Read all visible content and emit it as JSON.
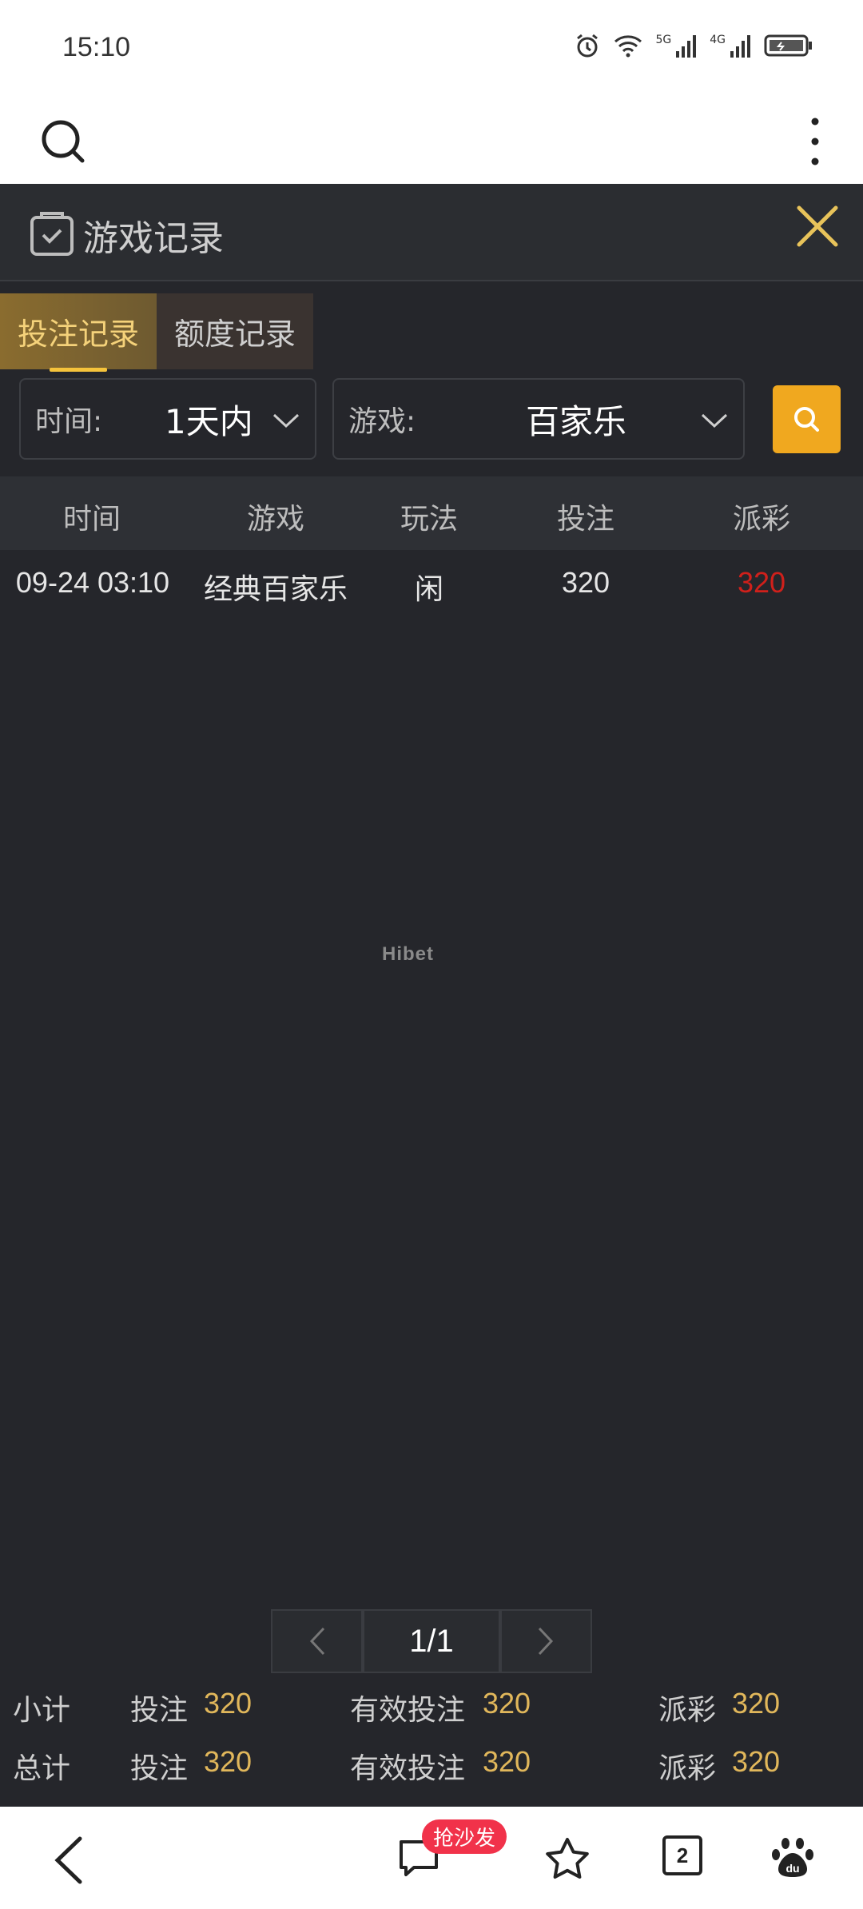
{
  "status_bar": {
    "time": "15:10",
    "network1": "5G",
    "network2": "4G"
  },
  "panel": {
    "title": "游戏记录"
  },
  "tabs": [
    {
      "label": "投注记录",
      "active": true
    },
    {
      "label": "额度记录",
      "active": false
    }
  ],
  "filters": {
    "time": {
      "label": "时间:",
      "value": "1天内"
    },
    "game": {
      "label": "游戏:",
      "value": "百家乐"
    }
  },
  "table": {
    "headers": [
      "时间",
      "游戏",
      "玩法",
      "投注",
      "派彩"
    ],
    "rows": [
      {
        "time": "09-24 03:10",
        "game": "经典百家乐",
        "play": "闲",
        "bet": "320",
        "payout": "320"
      }
    ]
  },
  "watermark": "Hibet",
  "pagination": {
    "current": "1/1"
  },
  "summary": {
    "subtotal": {
      "label": "小计",
      "bet_label": "投注",
      "bet": "320",
      "valid_label": "有效投注",
      "valid": "320",
      "payout_label": "派彩",
      "payout": "320"
    },
    "total": {
      "label": "总计",
      "bet_label": "投注",
      "bet": "320",
      "valid_label": "有效投注",
      "valid": "320",
      "payout_label": "派彩",
      "payout": "320"
    }
  },
  "bottom_nav": {
    "comment_badge": "抢沙发",
    "tab_count": "2"
  },
  "colors": {
    "accent": "#f0a81f",
    "tab_active_text": "#f5d27a",
    "payout_red": "#d0201b",
    "value_gold": "#e1b75b"
  }
}
